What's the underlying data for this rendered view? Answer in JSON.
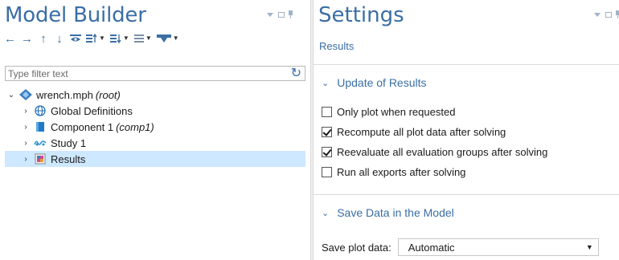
{
  "model_builder": {
    "title": "Model Builder",
    "toolbar_icons": [
      "arrow-left-icon",
      "arrow-right-icon",
      "arrow-up-icon",
      "arrow-down-icon",
      "show-icon",
      "sort-up-icon",
      "sort-down-icon",
      "list-icon",
      "add-node-icon"
    ],
    "filter_placeholder": "Type filter text",
    "tree": [
      {
        "label": "wrench.mph",
        "sub": "(root)",
        "icon": "model-icon",
        "expanded": true,
        "level": 0
      },
      {
        "label": "Global Definitions",
        "sub": "",
        "icon": "globe-icon",
        "expanded": false,
        "level": 1
      },
      {
        "label": "Component 1",
        "sub": "(comp1)",
        "icon": "component-icon",
        "expanded": false,
        "level": 1
      },
      {
        "label": "Study 1",
        "sub": "",
        "icon": "study-icon",
        "expanded": false,
        "level": 1
      },
      {
        "label": "Results",
        "sub": "",
        "icon": "results-icon",
        "expanded": false,
        "level": 1,
        "selected": true
      }
    ]
  },
  "settings": {
    "title": "Settings",
    "subtitle": "Results",
    "sections": [
      {
        "title": "Update of Results",
        "checkboxes": [
          {
            "label": "Only plot when requested",
            "checked": false
          },
          {
            "label": "Recompute all plot data after solving",
            "checked": true
          },
          {
            "label": "Reevaluate all evaluation groups after solving",
            "checked": true
          },
          {
            "label": "Run all exports after solving",
            "checked": false
          }
        ]
      },
      {
        "title": "Save Data in the Model",
        "save_plot_label": "Save plot data:",
        "save_plot_value": "Automatic"
      }
    ]
  },
  "colors": {
    "accent": "#3a6ea5",
    "selection": "#cde8ff"
  }
}
